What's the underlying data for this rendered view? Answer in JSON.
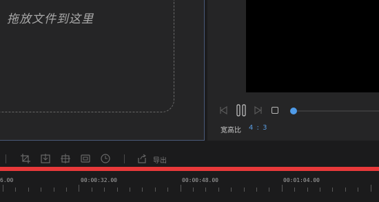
{
  "media_panel": {
    "drop_hint": "拖放文件到这里"
  },
  "preview": {
    "aspect_ratio_label": "宽高比",
    "aspect_ratio_value": "4 : 3",
    "progress_fraction": 0.0
  },
  "toolbar": {
    "icons": [
      "crop-icon",
      "fit-icon",
      "split-icon",
      "freeze-frame-icon",
      "speed-icon"
    ],
    "export_label": "导出"
  },
  "timeline": {
    "ticks": [
      "6.00",
      "00:00:32.00",
      "00:00:48.00",
      "00:01:04.00"
    ]
  },
  "colors": {
    "accent": "#4f9be8",
    "timeline_bar": "#e8393a"
  }
}
